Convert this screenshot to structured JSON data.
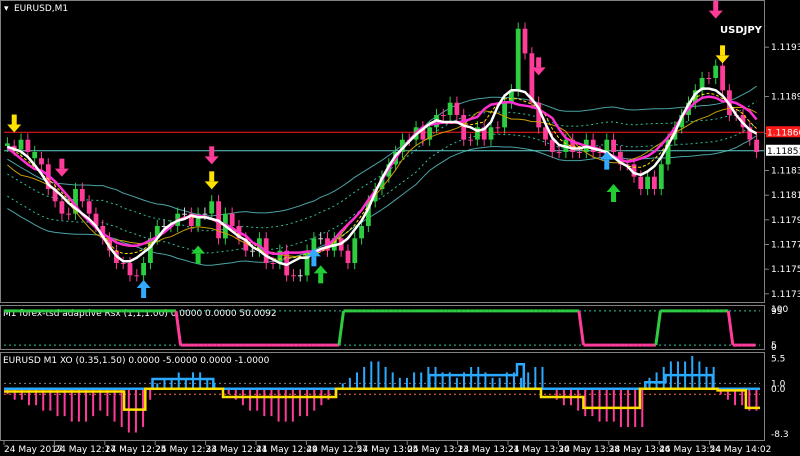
{
  "window": {
    "symbol_title": "EURUSD,M1",
    "overlay_label": "USDJPY"
  },
  "colors": {
    "background": "#000000",
    "frame": "#808080",
    "bull": "#2ecc40",
    "bear": "#ff3c9a",
    "doji": "#d8d8d8",
    "ma_white": "#ffffff",
    "ma_magenta": "#ff2fd1",
    "ma_gold": "#c8a000",
    "ma_yellow": "#ffe100",
    "channel": "#4aa3a3",
    "channel_dotted": "#2fbfa0",
    "hline_red": "#ff1a1a",
    "hline_cyan": "#5fd0d0",
    "arrow_up_green": "#22cc33",
    "arrow_up_blue": "#33aaff",
    "arrow_down_pink": "#ff3c9a",
    "arrow_down_yellow": "#ffe100",
    "price_tag_red": "#ff1a1a",
    "price_tag_white": "#ffffff"
  },
  "chart_data": [
    {
      "type": "candlestick",
      "title": "EURUSD,M1",
      "y_ticks": [
        "1.11935",
        "1.11895",
        "1.11865",
        "1.11835",
        "1.11815",
        "1.11795",
        "1.11775",
        "1.11755",
        "1.11735"
      ],
      "price_tags": [
        "1.11866",
        "1.11851"
      ],
      "x_ticks": [
        "24 May 2017",
        "24 May 12:17",
        "24 May 12:25",
        "24 May 12:33",
        "24 May 12:41",
        "24 May 12:49",
        "24 May 12:57",
        "24 May 13:05",
        "24 May 13:13",
        "24 May 13:21",
        "24 May 13:30",
        "24 May 13:38",
        "24 May 13:46",
        "24 May 13:54",
        "24 May 14:02"
      ],
      "ylim": [
        1.1173,
        1.1197
      ],
      "series": [
        {
          "close": [
            1.11855,
            1.11852,
            1.1186,
            1.1185,
            1.11845,
            1.1184,
            1.1182,
            1.1181,
            1.118,
            1.118,
            1.1182,
            1.1181,
            1.118,
            1.1179,
            1.1178,
            1.1177,
            1.1176,
            1.1176,
            1.1175,
            1.1175,
            1.1176,
            1.1178,
            1.1179,
            1.1179,
            1.1179,
            1.118,
            1.118,
            1.1179,
            1.118,
            1.118,
            1.1181,
            1.1178,
            1.118,
            1.1179,
            1.1178,
            1.1177,
            1.1177,
            1.1178,
            1.1176,
            1.1176,
            1.1177,
            1.1175,
            1.1175,
            1.1175,
            1.1177,
            1.1178,
            1.1178,
            1.1177,
            1.1178,
            1.1177,
            1.1176,
            1.1178,
            1.1179,
            1.1181,
            1.1182,
            1.1183,
            1.1184,
            1.1185,
            1.1186,
            1.1186,
            1.1187,
            1.1186,
            1.1187,
            1.1188,
            1.1188,
            1.1189,
            1.1188,
            1.1186,
            1.1186,
            1.1187,
            1.1186,
            1.1187,
            1.1187,
            1.1189,
            1.119,
            1.1195,
            1.1193,
            1.1189,
            1.1187,
            1.1186,
            1.1185,
            1.1185,
            1.1186,
            1.1185,
            1.1185,
            1.1186,
            1.1185,
            1.1185,
            1.1186,
            1.1185,
            1.1184,
            1.1184,
            1.1183,
            1.1182,
            1.1183,
            1.1182,
            1.1184,
            1.1186,
            1.1187,
            1.1188,
            1.1189,
            1.119,
            1.1191,
            1.1191,
            1.1192,
            1.119,
            1.1188,
            1.1188,
            1.1187,
            1.1186,
            1.1185
          ],
          "up": [
            1,
            0,
            1,
            0,
            1,
            0,
            0,
            0,
            0,
            0,
            1,
            0,
            0,
            0,
            0,
            0,
            0,
            0,
            0,
            0,
            1,
            1,
            1,
            2,
            1,
            1,
            2,
            0,
            1,
            2,
            1,
            0,
            1,
            0,
            0,
            0,
            2,
            1,
            0,
            0,
            1,
            0,
            0,
            2,
            1,
            1,
            2,
            0,
            1,
            0,
            0,
            1,
            1,
            1,
            1,
            1,
            1,
            1,
            1,
            0,
            1,
            0,
            1,
            1,
            0,
            1,
            0,
            0,
            0,
            1,
            0,
            1,
            0,
            1,
            1,
            1,
            0,
            0,
            0,
            0,
            0,
            0,
            1,
            0,
            0,
            1,
            0,
            0,
            1,
            0,
            0,
            0,
            0,
            0,
            1,
            0,
            1,
            1,
            1,
            1,
            1,
            1,
            1,
            0,
            1,
            0,
            0,
            0,
            0,
            0,
            0
          ]
        }
      ]
    },
    {
      "type": "line",
      "title": "M1 forex-tsd adaptive Rsx (1,1,1.00) 0.0000 0.0000 50.0092",
      "y_ticks": [
        "100",
        "95",
        "5",
        "0"
      ],
      "ylim": [
        0,
        100
      ],
      "series": [
        {
          "values": [
            95,
            95,
            95,
            95,
            95,
            95,
            95,
            95,
            95,
            95,
            95,
            95,
            95,
            95,
            95,
            95,
            95,
            95,
            95,
            95,
            95,
            95,
            95,
            95,
            95,
            95,
            95,
            95,
            95,
            95,
            95,
            95,
            95,
            95,
            95,
            95,
            95,
            95,
            95,
            5,
            5,
            5,
            5,
            5,
            5,
            5,
            5,
            5,
            5,
            5,
            5,
            5,
            5,
            5,
            5,
            5,
            5,
            5,
            5,
            5,
            5,
            5,
            5,
            5,
            5,
            5,
            5,
            5,
            5,
            5,
            5,
            5,
            5,
            5,
            5,
            95,
            95,
            95,
            95,
            95,
            95,
            95,
            95,
            95,
            95,
            95,
            95,
            95,
            95,
            95,
            95,
            95,
            95,
            95,
            95,
            95,
            95,
            95,
            95,
            95,
            95,
            95,
            95,
            95,
            95,
            95,
            95,
            95,
            95,
            95,
            95,
            95,
            95,
            95,
            95,
            95,
            95,
            95,
            95,
            95,
            95,
            95,
            95,
            95,
            95,
            95,
            95,
            95,
            5,
            5,
            5,
            5,
            5,
            5,
            5,
            5,
            5,
            5,
            5,
            5,
            5,
            5,
            5,
            5,
            5,
            95,
            95,
            95,
            95,
            95,
            95,
            95,
            95,
            95,
            95,
            95,
            95,
            95,
            95,
            95,
            95,
            5,
            5,
            5,
            5,
            5,
            5
          ]
        }
      ]
    },
    {
      "type": "bar",
      "title": "EURUSD M1 XO (0.35,1.50) 0.0000 -5.0000 0.0000 -1.0000",
      "y_ticks": [
        "5.5",
        "1.0",
        "0.0",
        "-8.3"
      ],
      "ylim": [
        -9,
        6
      ],
      "series": [
        {
          "name": "histogram",
          "values": [
            -1,
            -2,
            -2,
            -3,
            -3,
            -4,
            -4,
            -5,
            -5,
            -6,
            -6,
            -6,
            -5,
            -4,
            -5,
            -6,
            -7,
            -8,
            -8,
            -7,
            -2,
            1,
            2,
            2,
            3,
            2,
            3,
            3,
            2,
            1,
            0,
            -1,
            -2,
            -3,
            -4,
            -4,
            -5,
            -5,
            -6,
            -6,
            -6,
            -5,
            -5,
            -4,
            -3,
            -2,
            -1,
            1,
            2,
            3,
            4,
            5,
            5,
            4,
            3,
            2,
            2,
            3,
            3,
            4,
            4,
            3,
            3,
            2,
            3,
            4,
            4,
            3,
            2,
            2,
            3,
            3,
            2,
            3,
            4,
            4,
            0,
            -2,
            -3,
            -3,
            -4,
            -5,
            -5,
            -6,
            -6,
            -6,
            -7,
            -7,
            -7,
            -7,
            2,
            3,
            4,
            5,
            5,
            5,
            6,
            5,
            4,
            4,
            -1,
            -2,
            -3,
            -3,
            -4,
            -4
          ]
        },
        {
          "name": "cyan",
          "values": [
            0,
            0,
            0,
            0,
            0,
            0,
            0,
            0,
            0,
            0,
            0,
            0,
            0,
            0,
            0,
            0,
            0,
            0,
            0,
            0,
            0,
            0,
            1.8,
            1.8,
            1.8,
            1.8,
            1.8,
            1.8,
            1.8,
            1.8,
            1.8,
            0,
            0,
            0,
            0,
            0,
            0,
            0,
            0,
            0,
            0,
            0,
            0,
            0,
            0,
            0,
            0,
            0,
            0,
            0,
            0,
            0,
            0,
            0,
            0,
            0,
            0,
            0,
            0,
            0,
            0,
            0,
            0,
            2.5,
            2.5,
            2.5,
            2.5,
            2.5,
            2.5,
            2.5,
            2.5,
            2.5,
            2.5,
            2.5,
            2.5,
            2.5,
            4.5,
            0,
            0,
            0,
            0,
            0,
            0,
            0,
            0,
            0,
            0,
            0,
            0,
            0,
            0,
            0,
            0,
            0,
            0,
            1.2,
            1.2,
            1.2,
            2.5,
            2.5,
            2.5,
            2.5,
            2.5,
            2.5,
            2.5,
            0,
            0,
            0,
            0,
            0,
            0,
            0
          ]
        },
        {
          "name": "yellow",
          "values": [
            -0.5,
            -0.5,
            -0.5,
            -0.5,
            -0.5,
            -0.5,
            -0.5,
            -0.5,
            -0.5,
            -0.5,
            -0.5,
            -0.5,
            -0.5,
            -0.5,
            -0.5,
            -0.5,
            -0.5,
            -3.8,
            -3.8,
            -3.8,
            0,
            0,
            0,
            0,
            0,
            0,
            0,
            0,
            0,
            0,
            0,
            -1.5,
            -1.5,
            -1.5,
            -1.5,
            -1.5,
            -1.5,
            -1.5,
            -1.5,
            -1.5,
            -1.5,
            -1.5,
            -1.5,
            -1.5,
            -1.5,
            -1.5,
            -1.5,
            0,
            0,
            0,
            0,
            0,
            0,
            0,
            0,
            0,
            0,
            0,
            0,
            0,
            0,
            0,
            0,
            0,
            0,
            0,
            0,
            0,
            0,
            0,
            0,
            0,
            0,
            0,
            0,
            0,
            -1.5,
            -1.5,
            -1.5,
            -1.5,
            -1.5,
            -1.5,
            -3.5,
            -3.5,
            -3.5,
            -3.5,
            -3.5,
            -3.5,
            -3.5,
            -3.5,
            0,
            0,
            0,
            0,
            0,
            0,
            0,
            0,
            0,
            0,
            0,
            -0.3,
            -0.3,
            -0.3,
            -0.3,
            -3.5,
            -3.5
          ]
        }
      ]
    }
  ],
  "indicators": {
    "rsx_title": "M1 forex-tsd adaptive Rsx (1,1,1.00) 0.0000 0.0000 50.0092",
    "xo_title": "EURUSD M1 XO (0.35,1.50) 0.0000 -5.0000 0.0000 -1.0000"
  }
}
